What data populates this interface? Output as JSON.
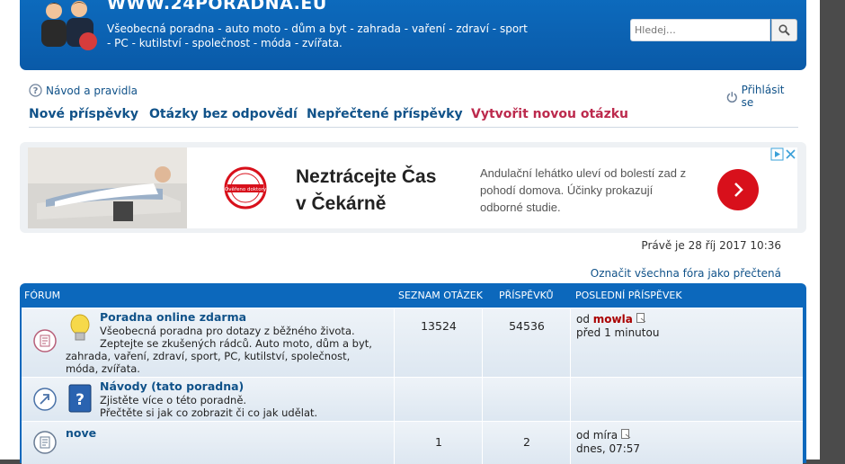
{
  "header": {
    "site_title": "WWW.24PORADNA.EU",
    "description_line1": "Všeobecná poradna - auto moto - dům a byt - zahrada - vaření - zdraví - sport",
    "description_line2": "- PC - kutilství - společnost - móda - zvířata.",
    "search_placeholder": "Hledej…"
  },
  "nav_top": {
    "rules_label": "Návod a pravidla",
    "login_label": "Přihlásit se"
  },
  "nav_links": {
    "new_posts": "Nové příspěvky",
    "unanswered": "Otázky bez odpovědí",
    "unread": "Nepřečtené příspěvky",
    "create": "Vytvořit novou otázku"
  },
  "ad": {
    "badge_text": "Ověřeno doktory",
    "headline_line1": "Neztrácejte Čas",
    "headline_line2": "v Čekárně",
    "text": "Andulační lehátko uleví od bolestí zad z pohodí domova. Účinky prokazují odborné studie."
  },
  "timestamp": "Právě je 28 říj 2017 10:36",
  "mark_read": "Označit všechna fóra jako přečtená",
  "forum": {
    "headers": {
      "forum": "FÓRUM",
      "topics": "SEZNAM OTÁZEK",
      "posts": "PŘÍSPĚVKŮ",
      "last_post": "POSLEDNÍ PŘÍSPĚVEK"
    },
    "rows": [
      {
        "title": "Poradna online zdarma",
        "desc1": "Všeobecná poradna pro dotazy z běžného života.",
        "desc2": "Zeptejte se zkušených rádců. Auto moto, dům a byt,",
        "desc3": "zahrada, vaření, zdraví, sport, PC, kutilství, společnost,",
        "desc4": "móda, zvířata.",
        "topics": "13524",
        "posts": "54536",
        "last_by_prefix": "od",
        "last_by": "mowla",
        "last_time": "před 1 minutou"
      },
      {
        "title": "Návody (tato poradna)",
        "desc1": "Zjistěte více o této poradně.",
        "desc2": "Přečtěte si jak co zobrazit či co jak udělat."
      },
      {
        "title": "nove",
        "topics": "1",
        "posts": "2",
        "last_by_prefix": "od",
        "last_by": "míra",
        "last_time": "dnes, 07:57"
      }
    ]
  },
  "colors": {
    "header_blue": "#0a5aa8",
    "link_blue": "#105289",
    "accent_red": "#bc2a4d",
    "ad_red": "#d8101b"
  }
}
